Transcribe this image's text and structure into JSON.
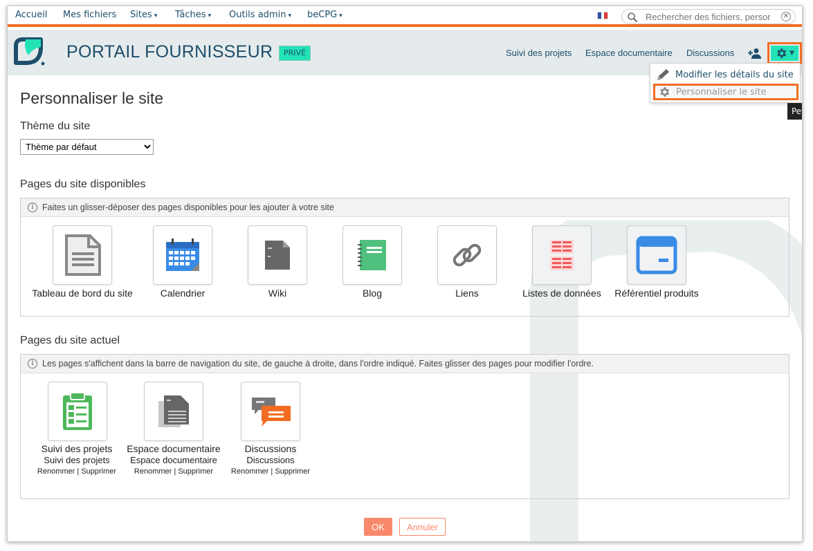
{
  "topnav": {
    "items": [
      {
        "label": "Accueil",
        "caret": ""
      },
      {
        "label": "Mes fichiers",
        "caret": ""
      },
      {
        "label": "Sites",
        "caret": "▾"
      },
      {
        "label": "Tâches",
        "caret": "▾"
      },
      {
        "label": "Outils admin",
        "caret": "▾"
      },
      {
        "label": "beCPG",
        "caret": "▾"
      }
    ],
    "search_placeholder": "Rechercher des fichiers, personnes, sites",
    "language_icon": "flag-fr-icon"
  },
  "site": {
    "title": "PORTAIL FOURNISSEUR",
    "badge": "PRIVÉ",
    "nav": [
      "Suivi des projets",
      "Espace documentaire",
      "Discussions"
    ],
    "accent_color": "#22e3b5",
    "highlight_color": "#f26d21"
  },
  "menu": {
    "edit": "Modifier les détails du site",
    "customize": "Personnaliser le site",
    "tooltip": "Pe"
  },
  "page": {
    "title": "Personnaliser le site",
    "theme_label": "Thème du site",
    "theme_value": "Thème par défaut",
    "available_label": "Pages du site disponibles",
    "available_info": "Faites un glisser-déposer des pages disponibles pour les ajouter à votre site",
    "current_label": "Pages du site actuel",
    "current_info": "Les pages s'affichent dans la barre de navigation du site, de gauche à droite, dans l'ordre indiqué. Faites glisser des pages pour modifier l'ordre.",
    "ok": "OK",
    "cancel": "Annuler"
  },
  "available_pages": [
    {
      "label": "Tableau de bord du site",
      "icon": "dashboard-document-icon"
    },
    {
      "label": "Calendrier",
      "icon": "calendar-icon"
    },
    {
      "label": "Wiki",
      "icon": "wiki-icon"
    },
    {
      "label": "Blog",
      "icon": "blog-notebook-icon"
    },
    {
      "label": "Liens",
      "icon": "link-chain-icon"
    },
    {
      "label": "Listes de données",
      "icon": "data-list-icon"
    },
    {
      "label": "Référentiel produits",
      "icon": "product-repository-icon"
    }
  ],
  "current_pages": [
    {
      "label": "Suivi des projets",
      "sub": "Suivi des projets",
      "rename": "Renommer",
      "sep": " | ",
      "delete": "Supprimer",
      "icon": "project-clipboard-icon"
    },
    {
      "label": "Espace documentaire",
      "sub": "Espace documentaire",
      "rename": "Renommer",
      "sep": " | ",
      "delete": "Supprimer",
      "icon": "document-library-icon"
    },
    {
      "label": "Discussions",
      "sub": "Discussions",
      "rename": "Renommer",
      "sep": " | ",
      "delete": "Supprimer",
      "icon": "discussion-bubbles-icon"
    }
  ]
}
